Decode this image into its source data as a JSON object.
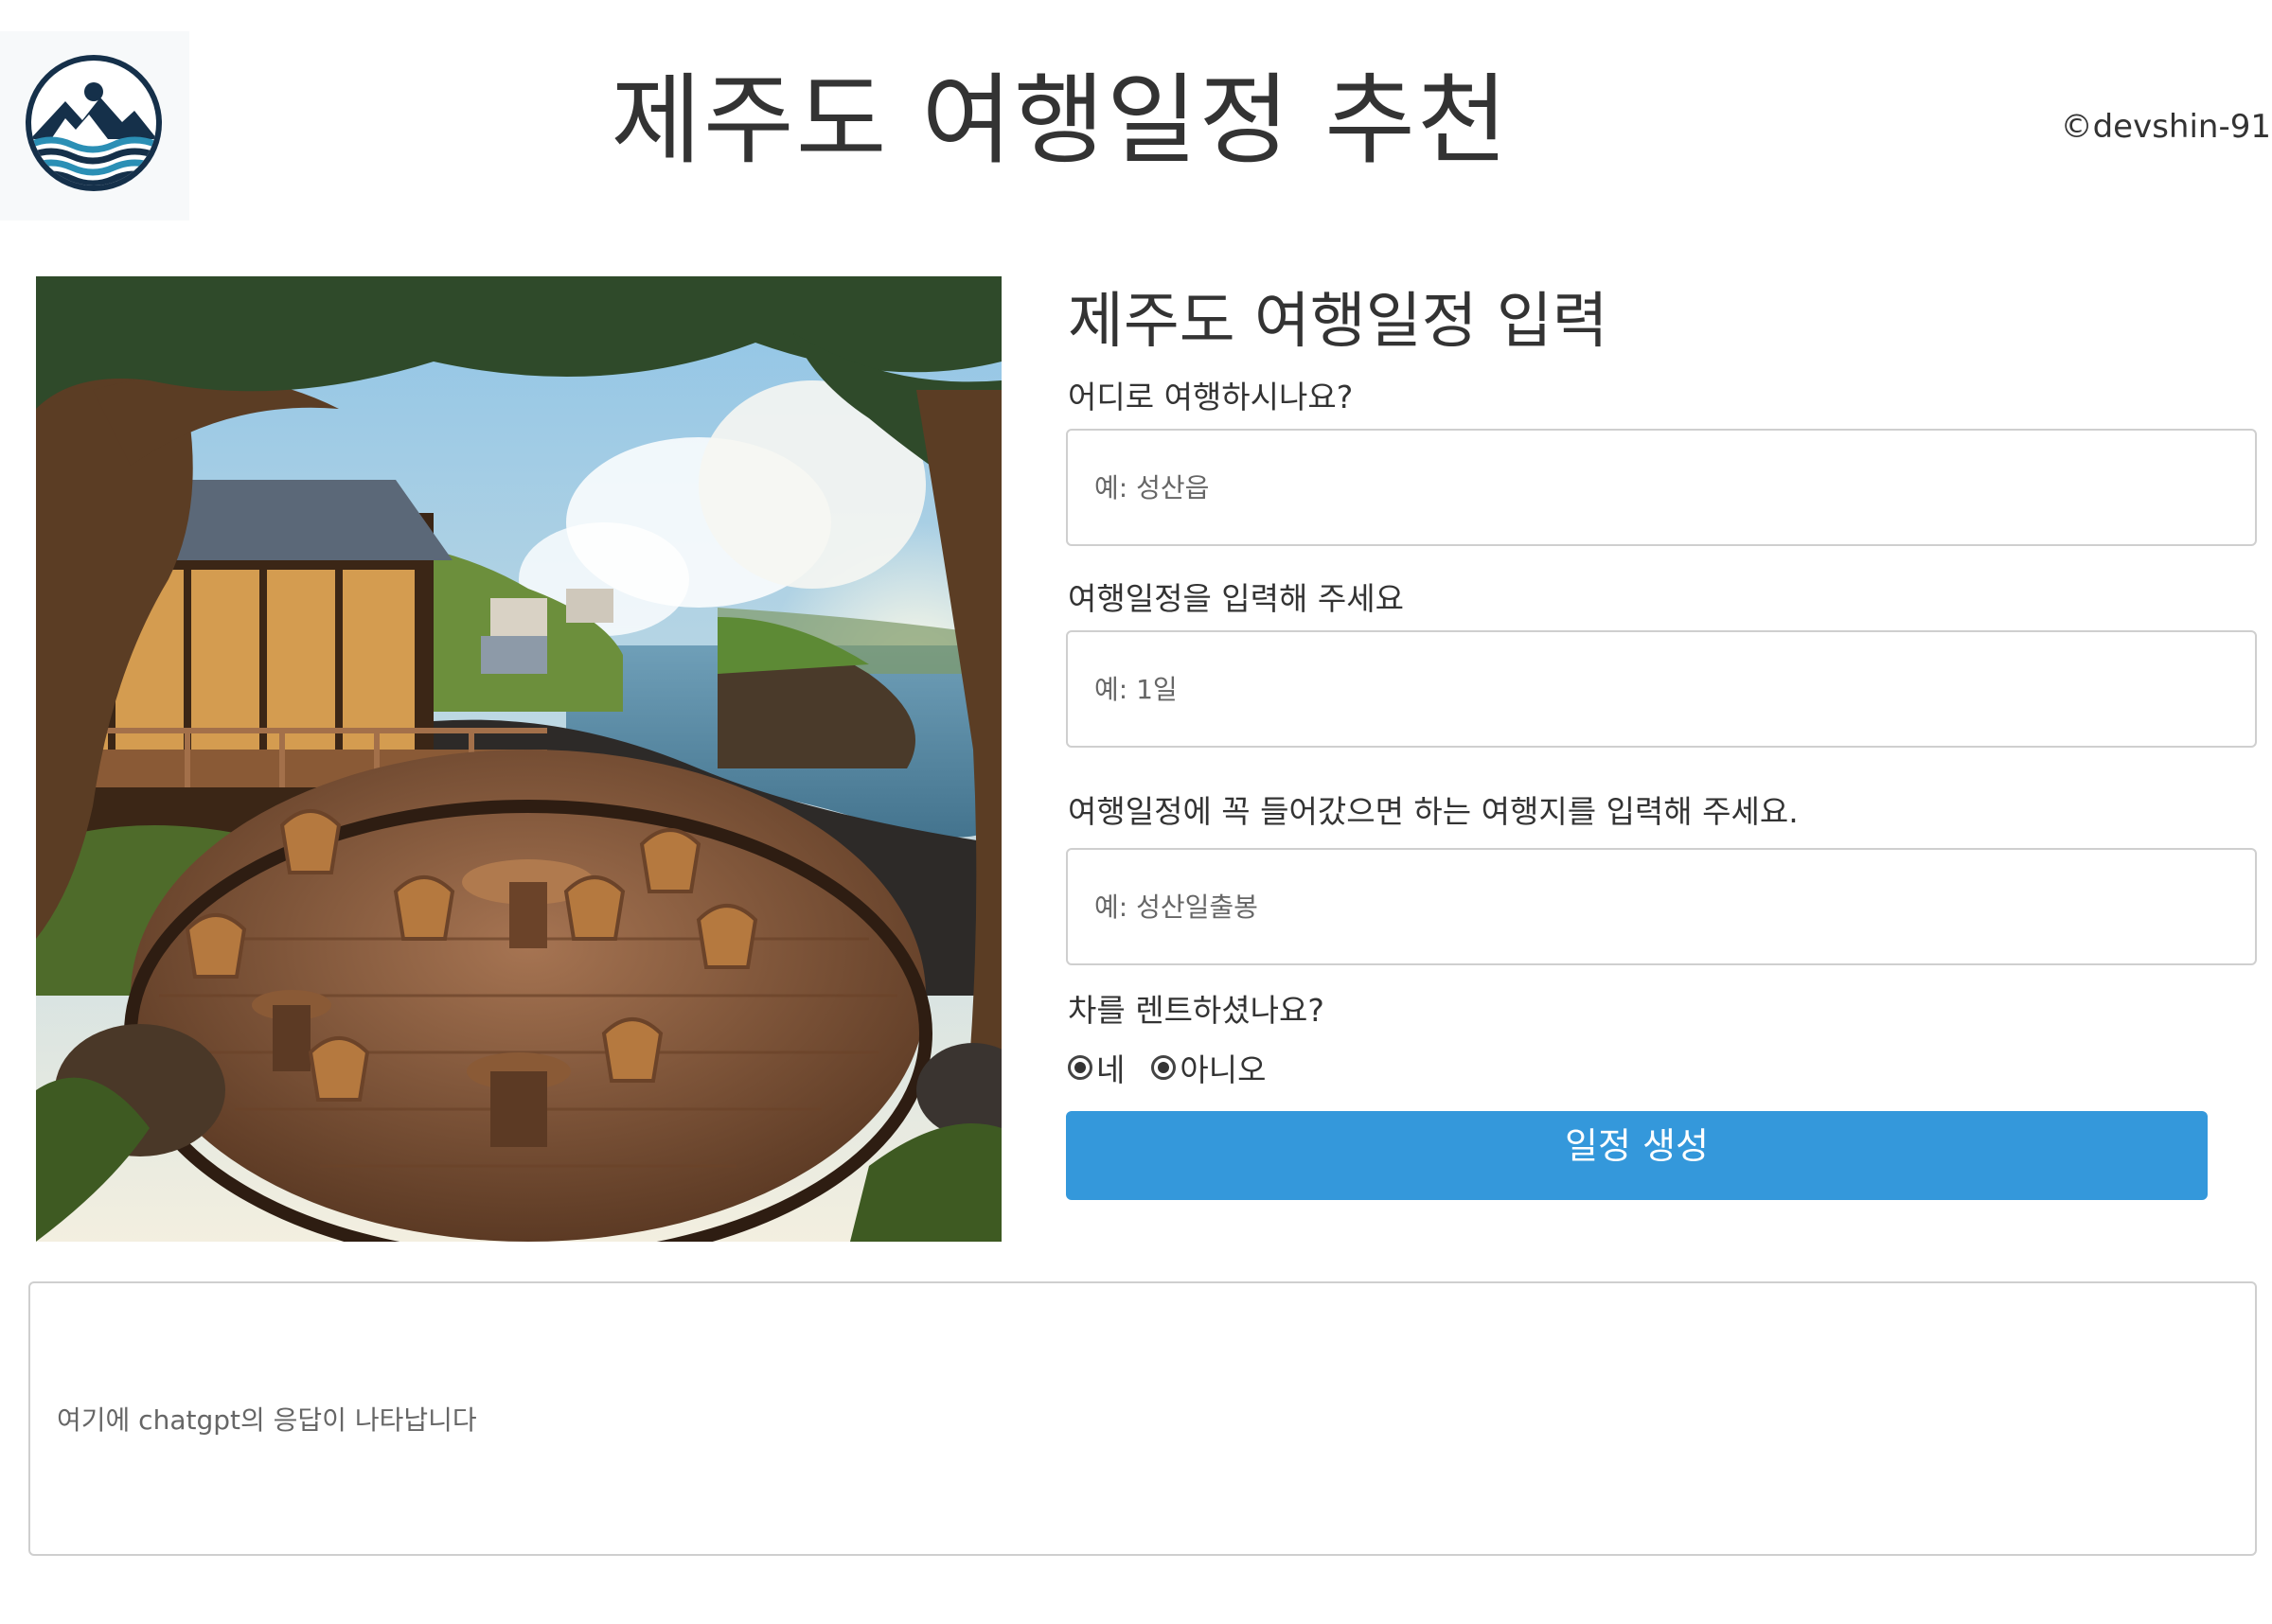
{
  "header": {
    "title": "제주도 여행일정 추천",
    "copyright": "©devshin-91",
    "logo_icon": "mountain-waves-logo-icon"
  },
  "hero_image": {
    "icon": "seaside-cafe-terrace-illustration"
  },
  "form": {
    "title": "제주도 여행일정 입력",
    "destination": {
      "label": "어디로 여행하시나요?",
      "placeholder": "예: 성산읍",
      "value": ""
    },
    "duration": {
      "label": "여행일정을 입력해 주세요",
      "placeholder": "예: 1일",
      "value": ""
    },
    "must_visit": {
      "label": "여행일정에 꼭 들어갔으면 하는 여행지를 입력해 주세요.",
      "placeholder": "예: 성산일출봉",
      "value": ""
    },
    "car_rental": {
      "label": "차를 렌트하셨나요?",
      "options": [
        {
          "label": "네",
          "selected": true
        },
        {
          "label": "아니오",
          "selected": true
        }
      ]
    },
    "submit_label": "일정 생성"
  },
  "result": {
    "placeholder": "여기에 chatgpt의 응답이 나타납니다"
  },
  "colors": {
    "accent": "#3498db",
    "text": "#333333",
    "border": "#cfcfcf"
  }
}
